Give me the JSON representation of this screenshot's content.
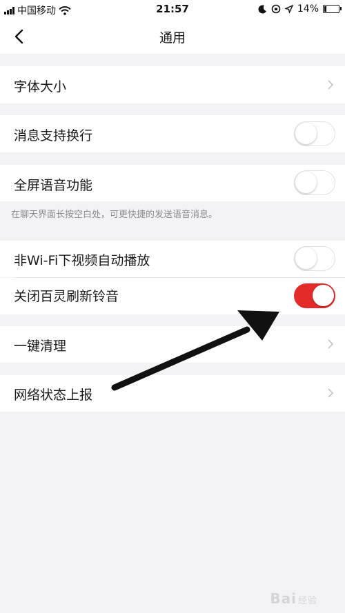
{
  "status_bar": {
    "carrier": "中国移动",
    "time": "21:57",
    "battery_percent": "14%",
    "battery_level": 0.14,
    "icons": [
      "signal-icon",
      "wifi-icon",
      "moon-icon",
      "orientation-lock-icon",
      "location-icon",
      "battery-icon"
    ]
  },
  "nav": {
    "title": "通用",
    "back_icon": "chevron-left-icon"
  },
  "settings": {
    "font_size": {
      "label": "字体大小"
    },
    "message_wrap": {
      "label": "消息支持换行",
      "enabled": false
    },
    "fullscreen_voice": {
      "label": "全屏语音功能",
      "enabled": false,
      "hint": "在聊天界面长按空白处，可更快捷的发送语音消息。"
    },
    "autoplay_video": {
      "label": "非Wi-Fi下视频自动播放",
      "enabled": false
    },
    "disable_refresh_sound": {
      "label": "关闭百灵刷新铃音",
      "enabled": true
    },
    "one_click_clean": {
      "label": "一键清理"
    },
    "network_report": {
      "label": "网络状态上报"
    }
  },
  "colors": {
    "accent": "#e32b2b",
    "background": "#f3f3f5",
    "cell": "#ffffff",
    "hint_text": "#8c8c90"
  },
  "watermark": {
    "text": "Bai",
    "suffix": "经验"
  }
}
